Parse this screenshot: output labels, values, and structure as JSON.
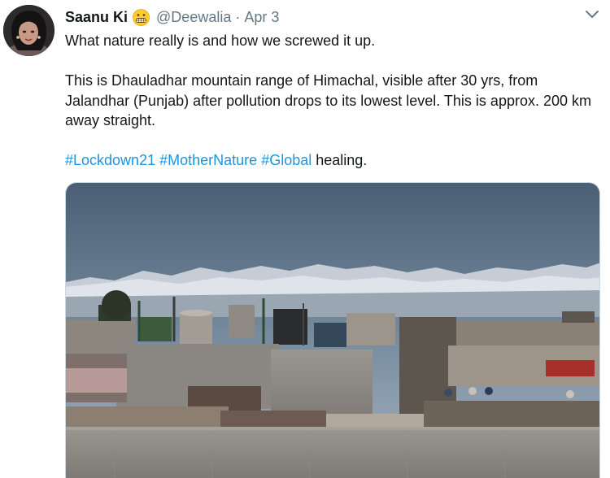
{
  "tweet": {
    "author_name": "Saanu Ki",
    "emoji_icon": "grimacing-face-emoji",
    "handle": "@Deewalia",
    "separator": "·",
    "date": "Apr 3",
    "line1": "What nature really is and how we screwed it up.",
    "line2": "This is Dhauladhar mountain range of Himachal, visible after 30 yrs, from Jalandhar (Punjab) after pollution drops to its lowest level. This is approx. 200 km away straight.",
    "hashtags": [
      "#Lockdown21",
      "#MotherNature",
      "#Global"
    ],
    "trailing_text": "healing."
  },
  "colors": {
    "link": "#1b95e0",
    "text": "#14171a",
    "muted": "#657786"
  }
}
